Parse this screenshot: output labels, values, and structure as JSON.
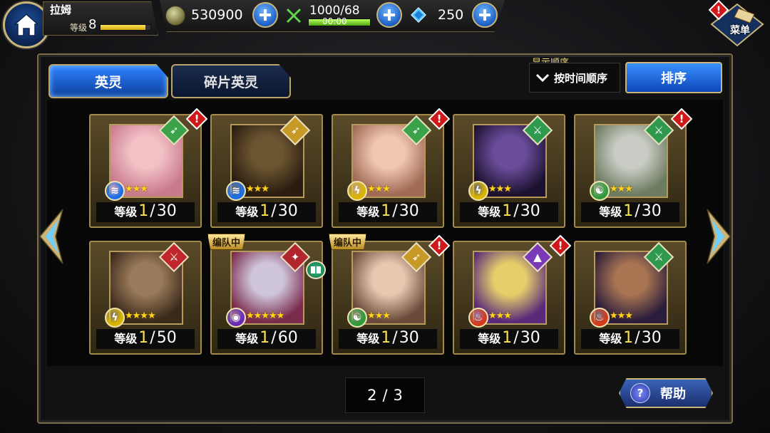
{
  "player": {
    "name": "拉姆",
    "level_label": "等级",
    "level": "8",
    "exp_fraction": 0.9
  },
  "resources": {
    "coins": "530900",
    "stamina": "1000/68",
    "stamina_timer": "00:00",
    "stamina_fraction": 1.0,
    "gems": "250"
  },
  "menu": {
    "label": "菜单"
  },
  "tabs": [
    {
      "label": "英灵",
      "active": true
    },
    {
      "label": "碎片英灵",
      "active": false
    }
  ],
  "sort": {
    "section_label": "显示顺序",
    "current": "按时间顺序",
    "button_label": "排序"
  },
  "level_label": "等级",
  "team_tag_label": "编队中",
  "cards": [
    {
      "level": "1",
      "max": "30",
      "stars": 3,
      "class_icon": "bow-icon",
      "class_color": "#3aa34a",
      "element": "water",
      "element_color": "#1c6ee8",
      "alert": true,
      "in_team": false,
      "portrait": [
        "#f2c1c6",
        "#c97b8c"
      ]
    },
    {
      "level": "1",
      "max": "30",
      "stars": 3,
      "class_icon": "bow-icon",
      "class_color": "#c79a28",
      "element": "water",
      "element_color": "#1c6ee8",
      "alert": false,
      "in_team": false,
      "portrait": [
        "#6b5430",
        "#2a1d10"
      ]
    },
    {
      "level": "1",
      "max": "30",
      "stars": 3,
      "class_icon": "bow-icon",
      "class_color": "#3aa34a",
      "element": "thunder",
      "element_color": "#d9b500",
      "alert": true,
      "in_team": false,
      "portrait": [
        "#f0c7b0",
        "#a06a55"
      ]
    },
    {
      "level": "1",
      "max": "30",
      "stars": 3,
      "class_icon": "sword-icon",
      "class_color": "#2f9a4e",
      "element": "thunder",
      "element_color": "#d9b500",
      "alert": false,
      "in_team": false,
      "portrait": [
        "#6a4c9a",
        "#1c1230"
      ]
    },
    {
      "level": "1",
      "max": "30",
      "stars": 3,
      "class_icon": "sword-icon",
      "class_color": "#2f9a4e",
      "element": "wind",
      "element_color": "#2f9a3a",
      "alert": true,
      "in_team": false,
      "portrait": [
        "#c9ccc4",
        "#6d7b60"
      ]
    },
    {
      "level": "1",
      "max": "50",
      "stars": 4,
      "class_icon": "sword-icon",
      "class_color": "#c0262c",
      "element": "thunder",
      "element_color": "#d9b500",
      "alert": false,
      "in_team": false,
      "portrait": [
        "#9a7a5a",
        "#3a2a1a"
      ]
    },
    {
      "level": "1",
      "max": "60",
      "stars": 5,
      "class_icon": "staff-icon",
      "class_color": "#b0262c",
      "element": "dark",
      "element_color": "#6a2bb8",
      "alert": false,
      "in_team": true,
      "has_book": true,
      "portrait": [
        "#d0c6dc",
        "#7a2b4c"
      ]
    },
    {
      "level": "1",
      "max": "30",
      "stars": 3,
      "class_icon": "bow-icon",
      "class_color": "#c79a28",
      "element": "wind",
      "element_color": "#2f9a3a",
      "alert": true,
      "in_team": true,
      "portrait": [
        "#e8c8b0",
        "#6a4b3a"
      ]
    },
    {
      "level": "1",
      "max": "30",
      "stars": 3,
      "class_icon": "hat-icon",
      "class_color": "#7a3ab8",
      "element": "fire",
      "element_color": "#d53a1a",
      "alert": true,
      "in_team": false,
      "portrait": [
        "#e6cf6a",
        "#5a2a7a"
      ]
    },
    {
      "level": "1",
      "max": "30",
      "stars": 3,
      "class_icon": "sword-icon",
      "class_color": "#2f9a4e",
      "element": "fire",
      "element_color": "#d53a1a",
      "alert": false,
      "in_team": false,
      "portrait": [
        "#a87452",
        "#2a1c3a"
      ]
    }
  ],
  "pagination": {
    "current": "2",
    "separator": "/",
    "total": "3"
  },
  "help": {
    "label": "帮助"
  }
}
